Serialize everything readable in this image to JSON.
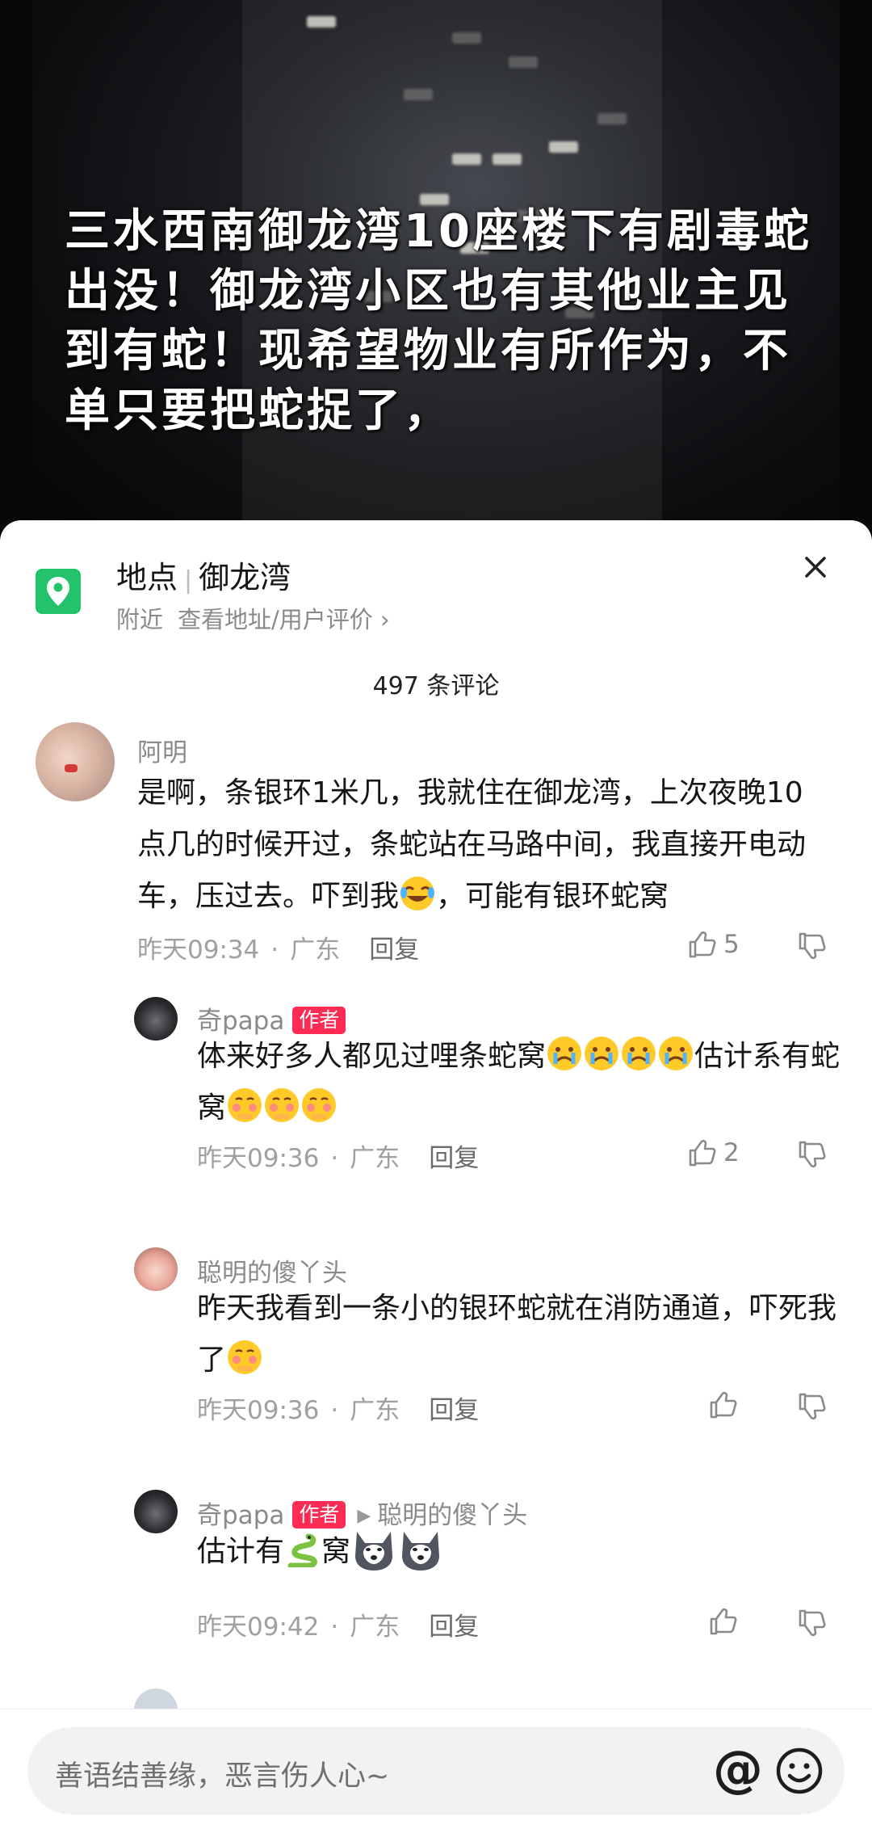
{
  "video": {
    "overlay_text": "三水西南御龙湾10座楼下有剧毒蛇出没！御龙湾小区也有其他业主见到有蛇！现希望物业有所作为，不单只要把蛇捉了，"
  },
  "location": {
    "label": "地点",
    "name": "御龙湾",
    "sub_left": "附近",
    "sub_link": "查看地址/用户评价 ›",
    "icon": "location-pin-icon",
    "icon_color": "#22c36a"
  },
  "comment_count": "497 条评论",
  "comments": [
    {
      "user": "阿明",
      "text": "是啊，条银环1米几，我就住在御龙湾，上次夜晚10点几的时候开过，条蛇站在马路中间，我直接开电动车，压过去。吓到我",
      "text_tail": "，可能有银环蛇窝",
      "time": "昨天09:34",
      "region": "广东",
      "reply": "回复",
      "likes": "5"
    },
    {
      "user": "奇papa",
      "badge": "作者",
      "text": "体来好多人都见过哩条蛇窝",
      "text2": "估计系有蛇窝",
      "time": "昨天09:36",
      "region": "广东",
      "reply": "回复",
      "likes": "2"
    },
    {
      "user": "聪明的傻丫头",
      "text": "昨天我看到一条小的银环蛇就在消防通道，吓死我了",
      "time": "昨天09:36",
      "region": "广东",
      "reply": "回复"
    },
    {
      "user": "奇papa",
      "badge": "作者",
      "reply_to": "聪明的傻丫头",
      "text_a": "估计有",
      "text_b": "窝",
      "time": "昨天09:42",
      "region": "广东",
      "reply": "回复"
    }
  ],
  "input": {
    "placeholder": "善语结善缘，恶言伤人心~",
    "at_symbol": "@"
  },
  "colors": {
    "accent": "#fe2c55",
    "location_green": "#22c36a"
  }
}
